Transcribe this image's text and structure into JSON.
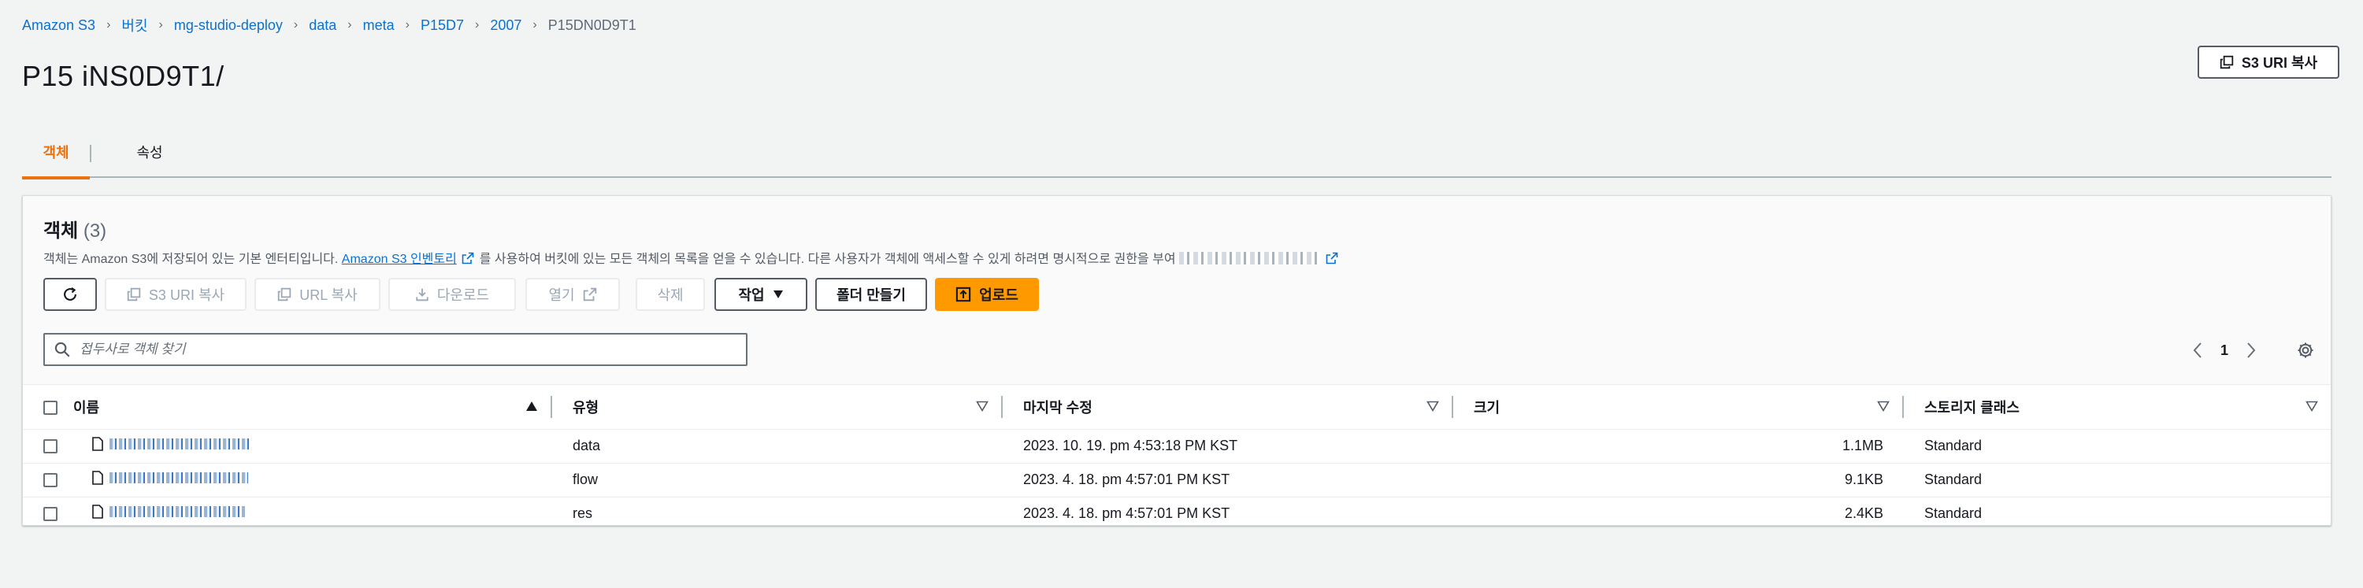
{
  "breadcrumb": [
    "Amazon S3",
    "버킷",
    "mg-studio-deploy",
    "data",
    "meta",
    "P15D7",
    "2007",
    "P15DN0D9T1"
  ],
  "page": {
    "title": "P15 iNS0D9T1/"
  },
  "header_buttons": {
    "copy_s3_uri": "S3 URI 복사"
  },
  "tabs": [
    {
      "label": "객체",
      "active": true
    },
    {
      "label": "속성",
      "active": false
    }
  ],
  "objects_panel": {
    "title": "객체",
    "count": "(3)",
    "description_pre": "객체는 Amazon S3에 저장되어 있는 기본 엔터티입니다.",
    "inventory_link": "Amazon S3 인벤토리",
    "description_post": "를 사용하여 버킷에 있는 모든 객체의 목록을 얻을 수 있습니다. 다른 사용자가 객체에 액세스할 수 있게 하려면 명시적으로 권한을 부여"
  },
  "actions": {
    "copy_s3_uri": "S3 URI 복사",
    "copy_url": "URL 복사",
    "download": "다운로드",
    "open": "열기",
    "delete": "삭제",
    "actions": "작업",
    "create_folder": "폴더 만들기",
    "upload": "업로드"
  },
  "search": {
    "placeholder": "접두사로 객체 찾기",
    "value": ""
  },
  "pagination": {
    "page": "1"
  },
  "table": {
    "columns": [
      "이름",
      "유형",
      "마지막 수정",
      "크기",
      "스토리지 클래스"
    ],
    "rows": [
      {
        "type": "data",
        "modified": "2023. 10. 19. pm 4:53:18 PM KST",
        "size": "1.1MB",
        "storage": "Standard"
      },
      {
        "type": "flow",
        "modified": "2023. 4. 18. pm 4:57:01 PM KST",
        "size": "9.1KB",
        "storage": "Standard"
      },
      {
        "type": "res",
        "modified": "2023. 4. 18. pm 4:57:01 PM KST",
        "size": "2.4KB",
        "storage": "Standard"
      }
    ]
  },
  "colors": {
    "accent": "#ec7211",
    "link": "#0972d3",
    "primary_button": "#ff9900"
  }
}
